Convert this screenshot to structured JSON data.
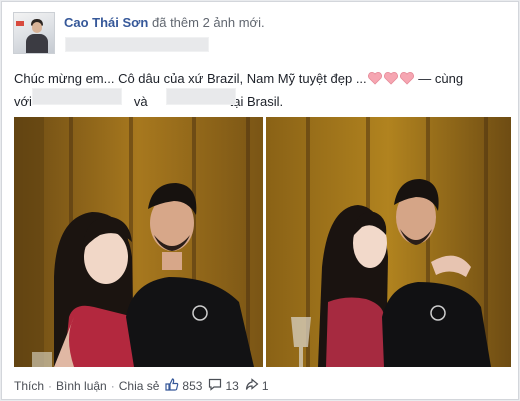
{
  "post": {
    "author": "Cao Thái Sơn",
    "action": "đã thêm 2 ảnh mới.",
    "text_line1": "Chúc mừng em... Cô dâu của xứ Brazil, Nam Mỹ tuyệt đẹp ...",
    "text_line1_tail": " — cùng",
    "text_line2_a": "với",
    "text_line2_b": "và",
    "text_line2_c": "tại Brasil."
  },
  "footer": {
    "like": "Thích",
    "comment": "Bình luận",
    "share": "Chia sẻ",
    "like_count": "853",
    "comment_count": "13",
    "share_count": "1",
    "separator": "·"
  },
  "colors": {
    "link_blue": "#365899",
    "heart": "#f6a6b2"
  },
  "icons": [
    "heart-icon",
    "thumbs-up-icon",
    "comment-icon",
    "share-icon"
  ]
}
